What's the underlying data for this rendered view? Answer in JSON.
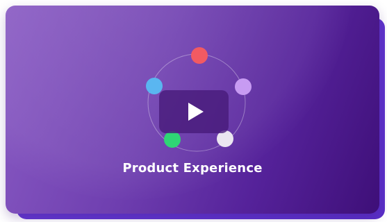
{
  "card": {
    "title": "Product Experience"
  },
  "icons": {
    "play": "play-icon"
  },
  "colors": {
    "node_top": "#f25a62",
    "node_right": "#c79bf2",
    "node_left": "#5ab6f0",
    "node_bottom_left": "#2fd675",
    "node_bottom_right": "#ebe6f0",
    "card_gradient_start": "#8a5cc4",
    "card_gradient_end": "#3e0f78"
  }
}
